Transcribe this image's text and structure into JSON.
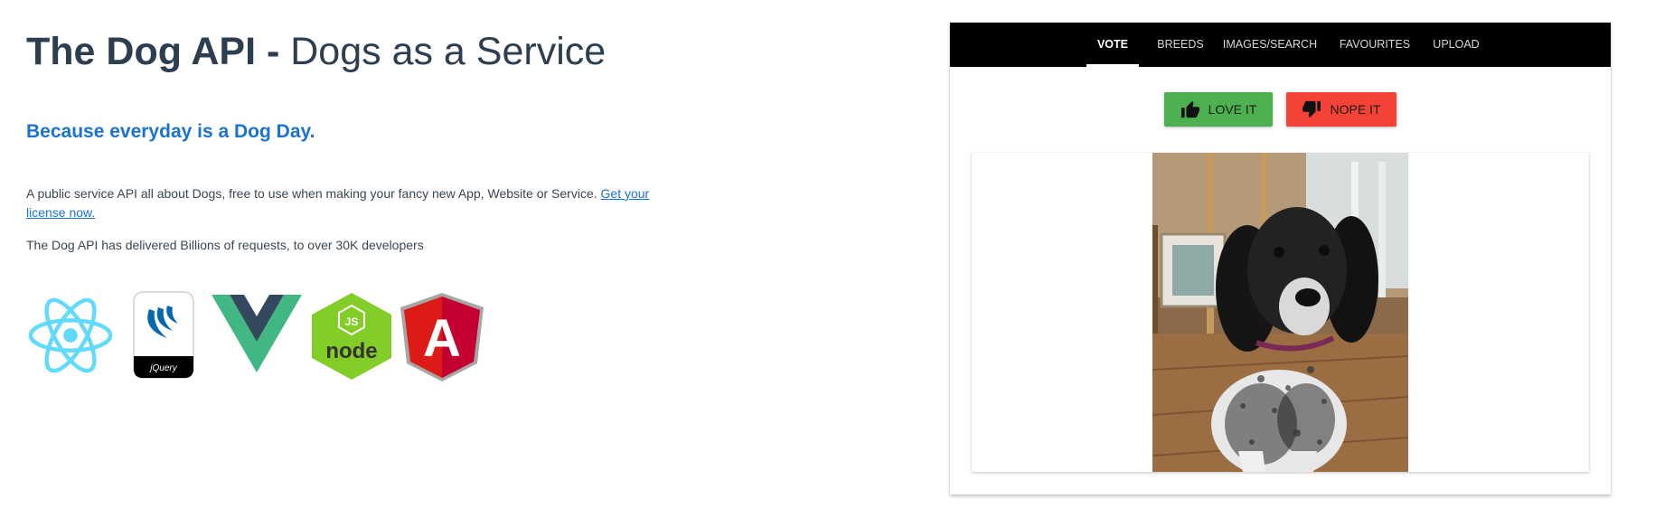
{
  "hero": {
    "title_bold": "The Dog API -",
    "title_light": "Dogs as a Service",
    "tagline": "Because everyday is a Dog Day.",
    "description": "A public service API all about Dogs, free to use when making your fancy new App, Website or Service.",
    "license_link": "Get your license now.",
    "stats": "The Dog API has delivered Billions of requests, to over 30K developers"
  },
  "logos": [
    {
      "name": "react-logo",
      "color": "#61dafb"
    },
    {
      "name": "jquery-logo",
      "text": "jQuery",
      "color": "#0769ad"
    },
    {
      "name": "vue-logo",
      "colors": [
        "#41b883",
        "#34495e"
      ]
    },
    {
      "name": "nodejs-logo",
      "badge": "JS",
      "text": "node",
      "color": "#83cd29"
    },
    {
      "name": "angular-logo",
      "letter": "A",
      "color": "#dd1b16"
    }
  ],
  "nav": {
    "tabs": [
      {
        "label": "VOTE",
        "active": true
      },
      {
        "label": "BREEDS",
        "active": false
      },
      {
        "label": "IMAGES/SEARCH",
        "active": false
      },
      {
        "label": "FAVOURITES",
        "active": false
      },
      {
        "label": "UPLOAD",
        "active": false
      }
    ]
  },
  "vote": {
    "love_label": "LOVE IT",
    "nope_label": "NOPE IT",
    "love_color": "#4caf50",
    "nope_color": "#f44336",
    "love_icon": "thumbs-up-icon",
    "nope_icon": "thumbs-down-icon"
  },
  "image": {
    "subject": "black and white spaniel dog sitting on wooden floor"
  }
}
